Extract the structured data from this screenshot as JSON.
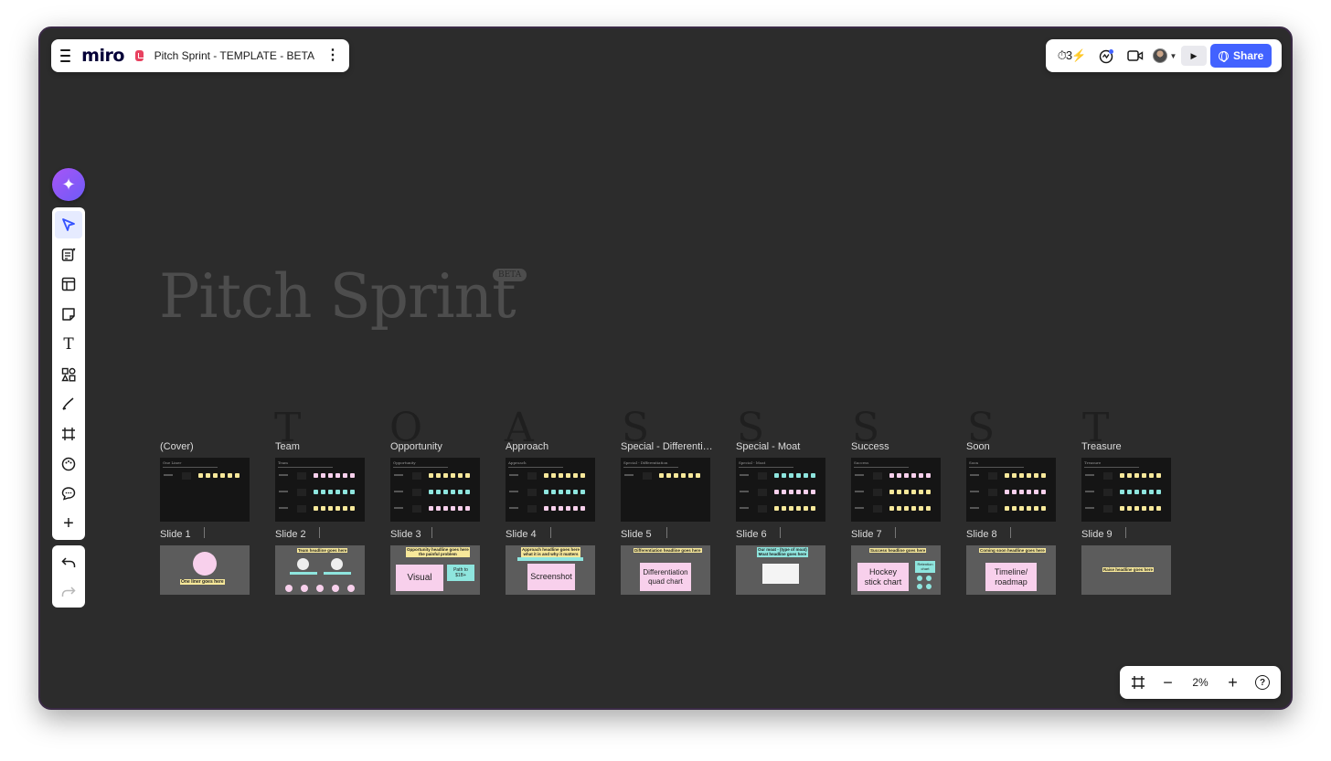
{
  "app": {
    "logo": "miro",
    "board_title": "Pitch Sprint - TEMPLATE - BETA"
  },
  "topbar_right": {
    "reactions_label": "⏱3⚡",
    "share_label": "Share"
  },
  "toolbar": {
    "tools": [
      "select",
      "templates",
      "layouts",
      "sticky-note",
      "text",
      "shapes",
      "pen",
      "frame",
      "sticker",
      "comment",
      "more"
    ],
    "text_tool_glyph": "T",
    "more_glyph": "+"
  },
  "zoom": {
    "level": "2%"
  },
  "canvas": {
    "title": "Pitch Sprint",
    "badge": "BETA",
    "letters": [
      "T",
      "O",
      "A",
      "S",
      "S",
      "S",
      "S",
      "T"
    ],
    "sections": [
      "(Cover)",
      "Team",
      "Opportunity",
      "Approach",
      "Special - Differentiation",
      "Special - Moat",
      "Success",
      "Soon",
      "Treasure"
    ],
    "section_frame_titles": [
      "One Liner",
      "Team",
      "Opportunity",
      "Approach",
      "Special - Differentiation",
      "Special - Moat",
      "Success",
      "Soon",
      "Treasure"
    ],
    "slides": [
      "Slide 1",
      "Slide 2",
      "Slide 3",
      "Slide 4",
      "Slide 5",
      "Slide 6",
      "Slide 7",
      "Slide 8",
      "Slide 9"
    ],
    "slide_content": {
      "s1_headline": "One liner goes here",
      "s2_headline": "Team headline goes here",
      "s3_headline": "Opportunity headline goes here\nthe painful problem",
      "s3_visual": "Visual",
      "s3_path": "Path to\n$1B+",
      "s4_headline": "Approach headline goes here\nwhat it is and why it matters",
      "s4_screenshot": "Screenshot",
      "s5_headline": "Differentiation headline goes here",
      "s5_quad": "Differentiation\nquad chart",
      "s6_headline": "Our moat - (type of moat)\nMoat headline goes here",
      "s7_headline": "Success headline goes here",
      "s7_hockey": "Hockey\nstick chart",
      "s7_retention": "Retention\nchart",
      "s8_headline": "Coming soon headline goes here",
      "s8_timeline": "Timeline/\nroadmap",
      "s9_headline": "Raise headline goes here"
    }
  },
  "colors": {
    "canvas_bg": "#2c2c2c",
    "accent": "#4262ff",
    "sticky_yellow": "#f7e89a",
    "sticky_pink": "#f8d0ec",
    "sticky_teal": "#8ee5de"
  }
}
